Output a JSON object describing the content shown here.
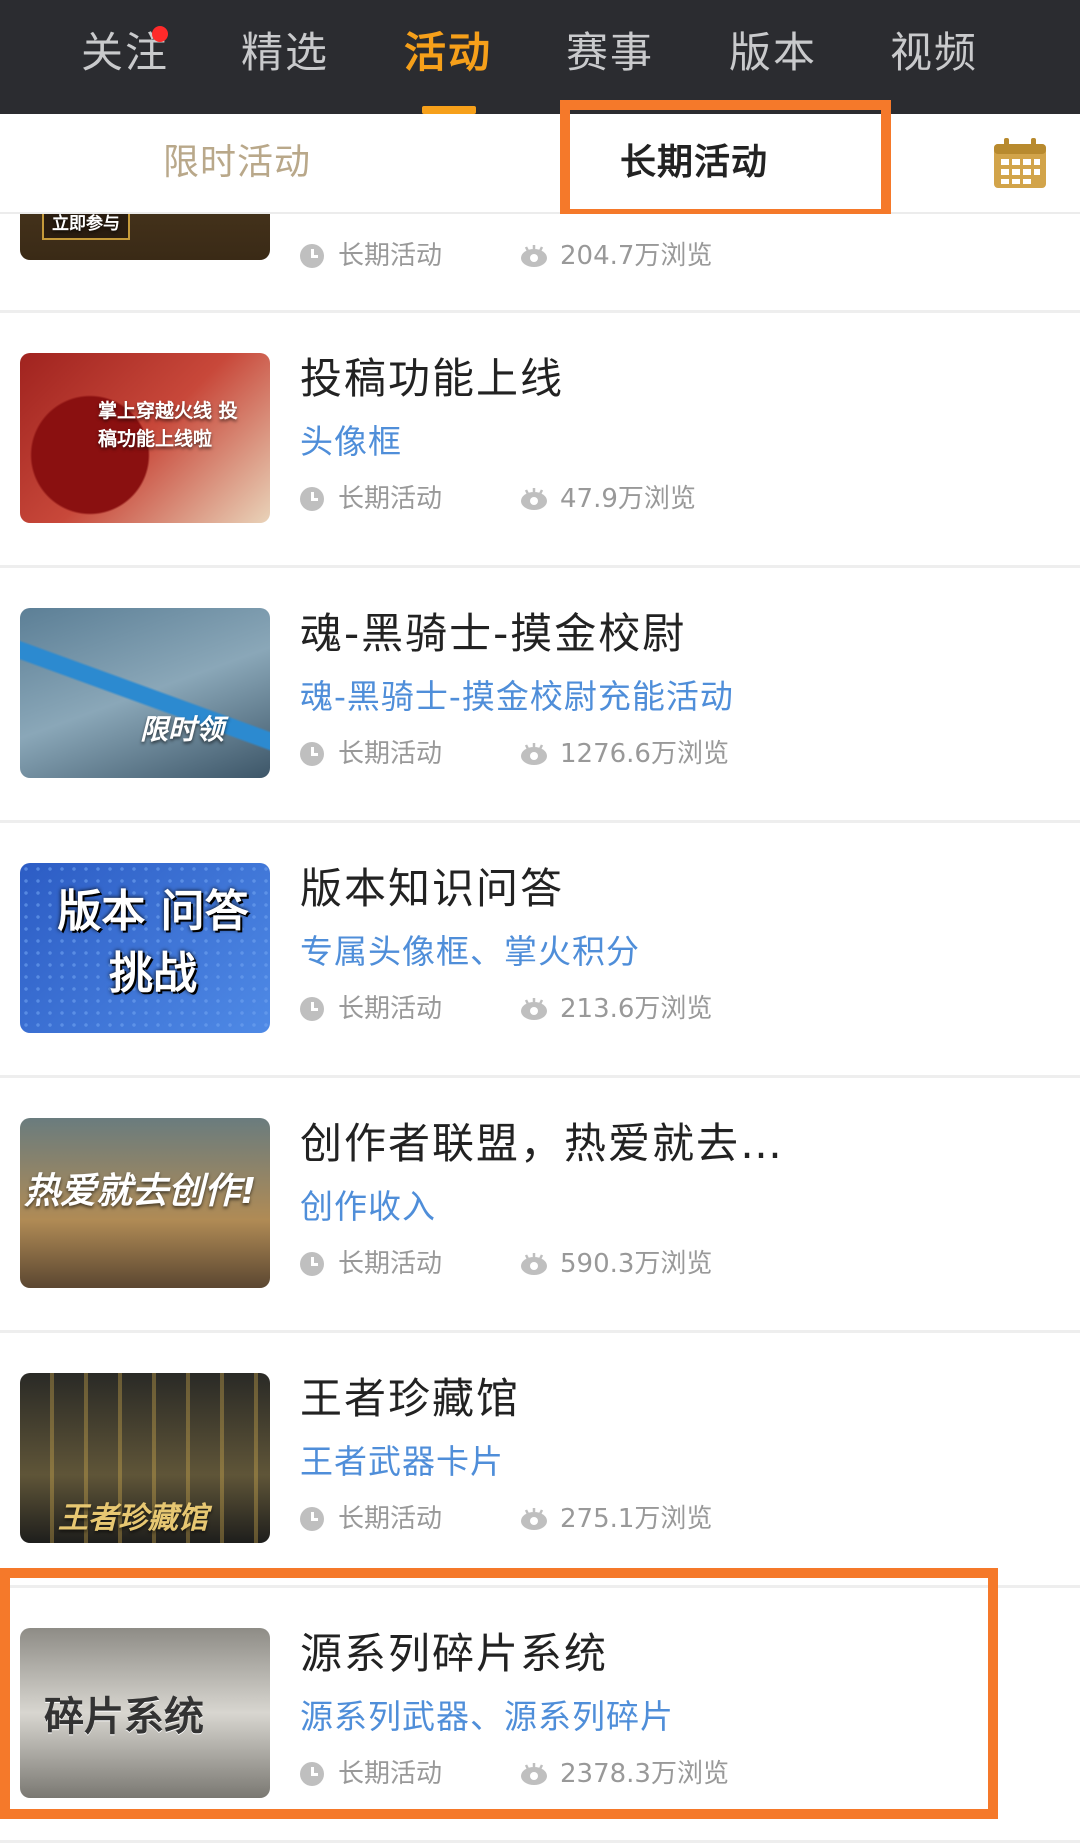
{
  "topnav": {
    "tabs": [
      {
        "label": "关注",
        "has_dot": true
      },
      {
        "label": "精选"
      },
      {
        "label": "活动",
        "active": true
      },
      {
        "label": "赛事"
      },
      {
        "label": "版本"
      },
      {
        "label": "视频"
      }
    ]
  },
  "subtabs": {
    "inactive": "限时活动",
    "active": "长期活动"
  },
  "icons": {
    "calendar": "calendar-icon",
    "clock": "clock-icon",
    "views": "eye-icon"
  },
  "colors": {
    "nav_bg": "#2b2c30",
    "accent": "#f6a01a",
    "link": "#4f8ed9",
    "highlight": "#f5792a"
  },
  "items": [
    {
      "title": "",
      "subtitle": "",
      "category": "长期活动",
      "views": "204.7万浏览",
      "thumb_text": "立即参与"
    },
    {
      "title": "投稿功能上线",
      "subtitle": "头像框",
      "category": "长期活动",
      "views": "47.9万浏览",
      "thumb_text": "掌上穿越火线 投稿功能上线啦"
    },
    {
      "title": "魂-黑骑士-摸金校尉",
      "subtitle": "魂-黑骑士-摸金校尉充能活动",
      "category": "长期活动",
      "views": "1276.6万浏览",
      "thumb_text": "限时领"
    },
    {
      "title": "版本知识问答",
      "subtitle": "专属头像框、掌火积分",
      "category": "长期活动",
      "views": "213.6万浏览",
      "thumb_text": "版本 问答挑战"
    },
    {
      "title": "创作者联盟，热爱就去…",
      "subtitle": "创作收入",
      "category": "长期活动",
      "views": "590.3万浏览",
      "thumb_text": "热爱就去创作!"
    },
    {
      "title": "王者珍藏馆",
      "subtitle": "王者武器卡片",
      "category": "长期活动",
      "views": "275.1万浏览",
      "thumb_text": "王者珍藏馆"
    },
    {
      "title": "源系列碎片系统",
      "subtitle": "源系列武器、源系列碎片",
      "category": "长期活动",
      "views": "2378.3万浏览",
      "thumb_text": "碎片系统"
    }
  ]
}
